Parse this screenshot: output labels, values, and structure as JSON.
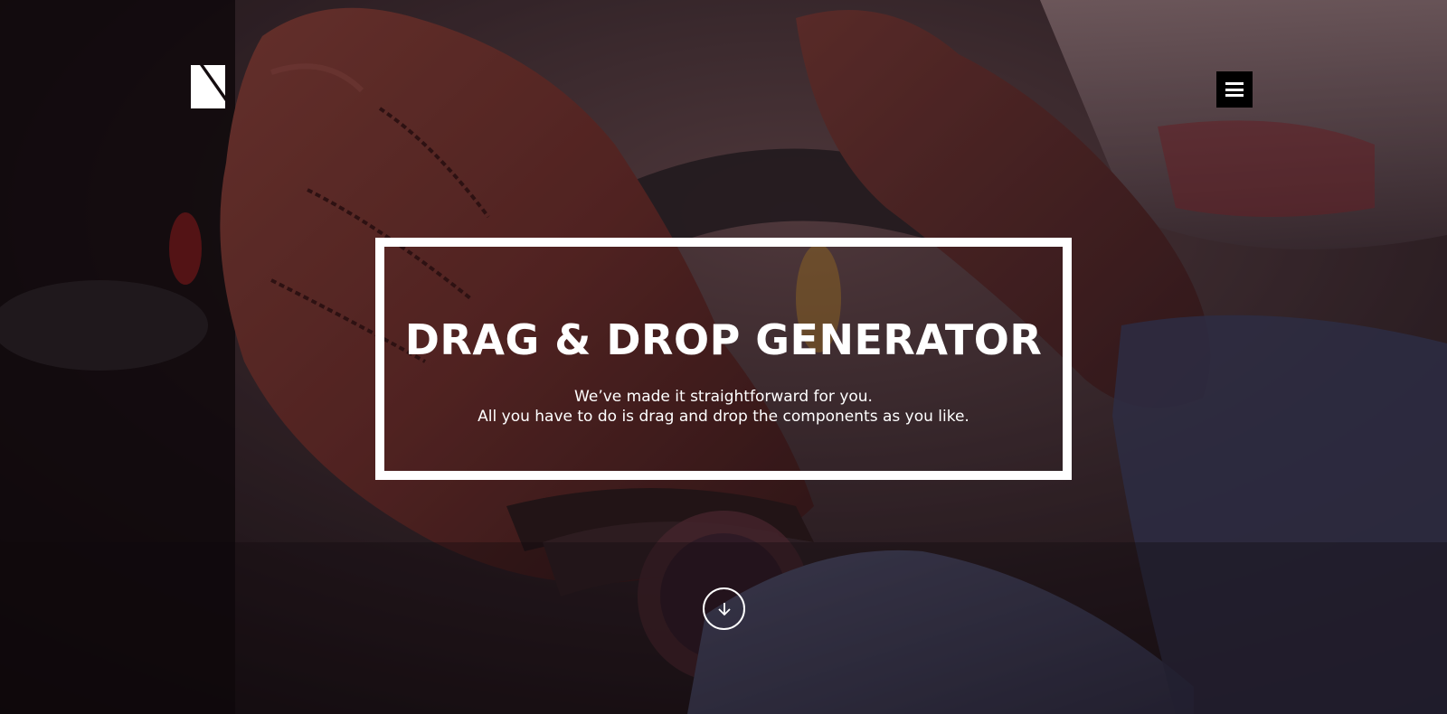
{
  "header": {
    "logo_name": "brand-logo",
    "menu_icon": "hamburger-menu-icon"
  },
  "hero": {
    "title": "DRAG & DROP GENERATOR",
    "subtitle_line1": "We’ve made it straightforward for you.",
    "subtitle_line2": "All you have to do is drag and drop the components as you like.",
    "scroll_icon": "arrow-down-icon"
  },
  "colors": {
    "text": "#ffffff",
    "frame": "#ffffff",
    "menu_bg": "#000000",
    "glove": "#7a3a30",
    "sweater": "#5a6080"
  }
}
